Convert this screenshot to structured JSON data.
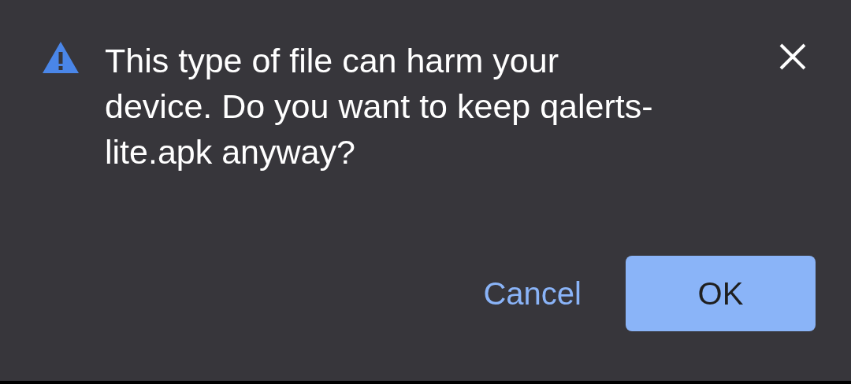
{
  "dialog": {
    "message": "This type of file can harm your device. Do you want to keep qalerts-lite.apk anyway?",
    "buttons": [
      {
        "label": "Cancel",
        "kind": "text"
      },
      {
        "label": "OK",
        "kind": "filled"
      }
    ]
  }
}
